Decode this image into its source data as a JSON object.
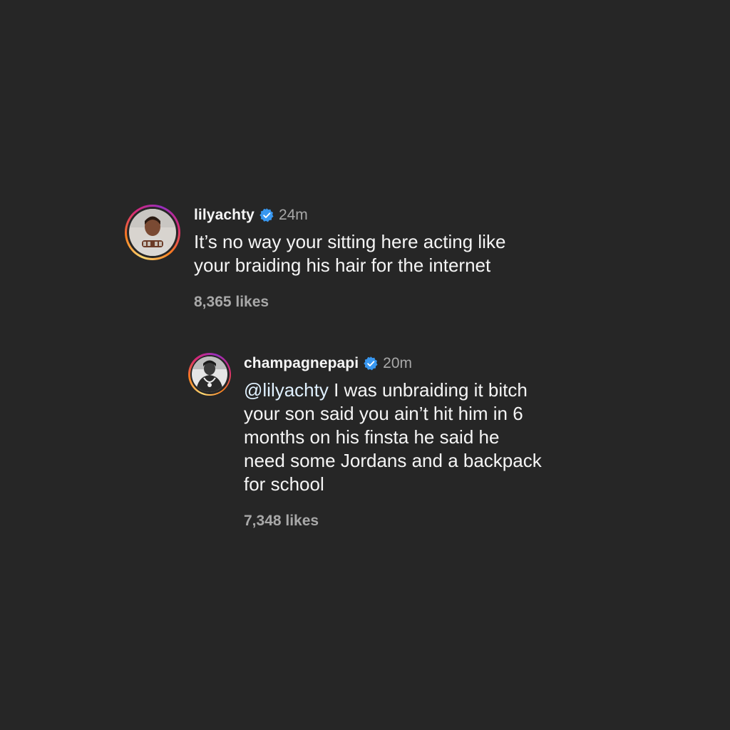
{
  "comments": [
    {
      "username": "lilyachty",
      "verified": true,
      "time": "24m",
      "lines": [
        "It’s no way your sitting here acting like",
        "your braiding his hair for the internet"
      ],
      "likes": "8,365 likes"
    }
  ],
  "reply": {
    "username": "champagnepapi",
    "verified": true,
    "time": "20m",
    "mention": "@lilyachty",
    "first_line_rest": " I was unbraiding it bitch",
    "lines": [
      "your son said you ain’t hit him in 6",
      "months on his finsta he said he",
      "need some Jordans and a backpack",
      "for school"
    ],
    "likes": "7,348 likes"
  },
  "colors": {
    "background": "#262626",
    "text": "#f5f5f5",
    "secondary": "#a8a8a8",
    "verified_badge": "#3897f0",
    "mention": "#e0f1ff"
  },
  "icons": {
    "verified": "verified-badge-icon"
  }
}
